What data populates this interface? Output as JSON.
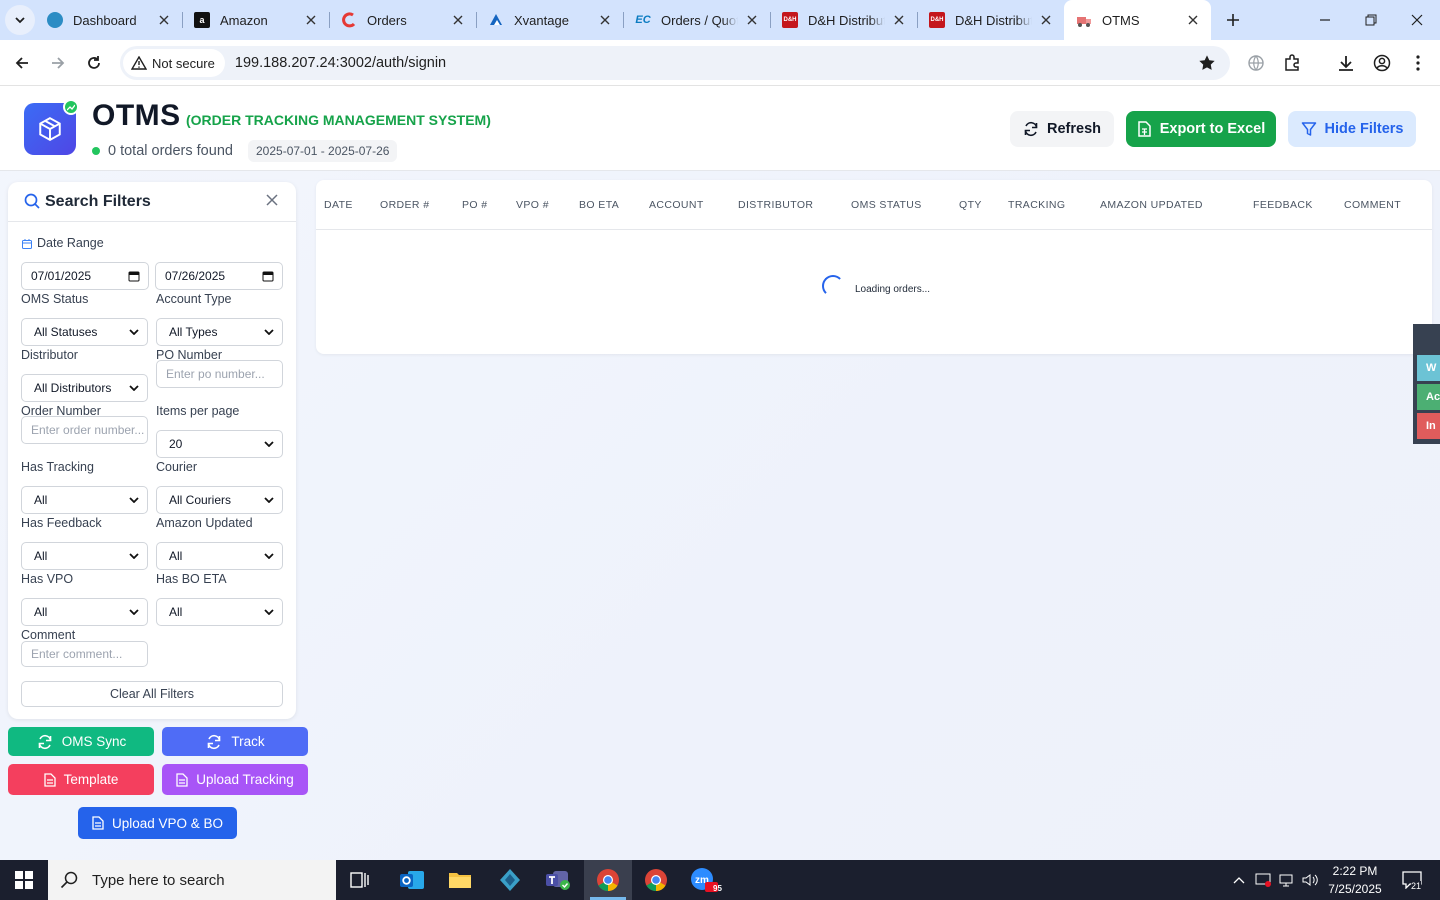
{
  "browser": {
    "tabs": [
      {
        "title": "Dashboard",
        "icon": "dashboard-favicon",
        "active": false
      },
      {
        "title": "Amazon",
        "icon": "amazon-favicon",
        "active": false
      },
      {
        "title": "Orders",
        "icon": "orders-favicon",
        "active": false
      },
      {
        "title": "Xvantage",
        "icon": "xvantage-favicon",
        "active": false
      },
      {
        "title": "Orders / Quotes",
        "icon": "ec-favicon",
        "active": false
      },
      {
        "title": "D&H Distributing",
        "icon": "dh-favicon",
        "active": false
      },
      {
        "title": "D&H Distributing",
        "icon": "dh-favicon",
        "active": false
      },
      {
        "title": "OTMS",
        "icon": "otms-favicon",
        "active": true
      }
    ],
    "security_label": "Not secure",
    "url": "199.188.207.24:3002/auth/signin"
  },
  "header": {
    "title": "OTMS",
    "subtitle": "(ORDER TRACKING MANAGEMENT SYSTEM)",
    "order_count": "0 total orders found",
    "date_range": "2025-07-01 - 2025-07-26",
    "refresh_label": "Refresh",
    "export_label": "Export to Excel",
    "hide_filters_label": "Hide Filters"
  },
  "filters": {
    "title": "Search Filters",
    "date_range_label": "Date Range",
    "date_from": "07/01/2025",
    "date_to": "07/26/2025",
    "oms_status_label": "OMS Status",
    "oms_status_value": "All Statuses",
    "account_type_label": "Account Type",
    "account_type_value": "All Types",
    "distributor_label": "Distributor",
    "distributor_value": "All Distributors",
    "po_number_label": "PO Number",
    "po_number_placeholder": "Enter po number...",
    "order_number_label": "Order Number",
    "order_number_placeholder": "Enter order number...",
    "items_per_page_label": "Items per page",
    "items_per_page_value": "20",
    "has_tracking_label": "Has Tracking",
    "has_tracking_value": "All",
    "courier_label": "Courier",
    "courier_value": "All Couriers",
    "has_feedback_label": "Has Feedback",
    "has_feedback_value": "All",
    "amazon_updated_label": "Amazon Updated",
    "amazon_updated_value": "All",
    "has_vpo_label": "Has VPO",
    "has_vpo_value": "All",
    "has_bo_eta_label": "Has BO ETA",
    "has_bo_eta_value": "All",
    "comment_label": "Comment",
    "comment_placeholder": "Enter comment...",
    "clear_label": "Clear All Filters"
  },
  "actions": {
    "oms_sync": "OMS Sync",
    "track": "Track",
    "template": "Template",
    "upload_tracking": "Upload Tracking",
    "upload_vpo_bo": "Upload VPO & BO"
  },
  "table": {
    "columns": [
      "DATE",
      "ORDER #",
      "PO #",
      "VPO #",
      "BO ETA",
      "ACCOUNT",
      "DISTRIBUTOR",
      "OMS STATUS",
      "QTY",
      "TRACKING",
      "AMAZON UPDATED",
      "FEEDBACK",
      "COMMENT"
    ],
    "loading_text": "Loading orders..."
  },
  "side_widgets": [
    "W",
    "Ac",
    "In"
  ],
  "taskbar": {
    "search_placeholder": "Type here to search",
    "time": "2:22 PM",
    "date": "7/25/2025",
    "notification_count": "21",
    "zoom_badge": "95"
  },
  "colors": {
    "primary_green": "#16a34a",
    "primary_blue": "#2563eb",
    "logo_blue": "#3b6cf5",
    "oms_sync_teal": "#10b981",
    "track_indigo": "#4f6cf6",
    "template_rose": "#f43f5e",
    "upload_purple": "#a855f7"
  }
}
